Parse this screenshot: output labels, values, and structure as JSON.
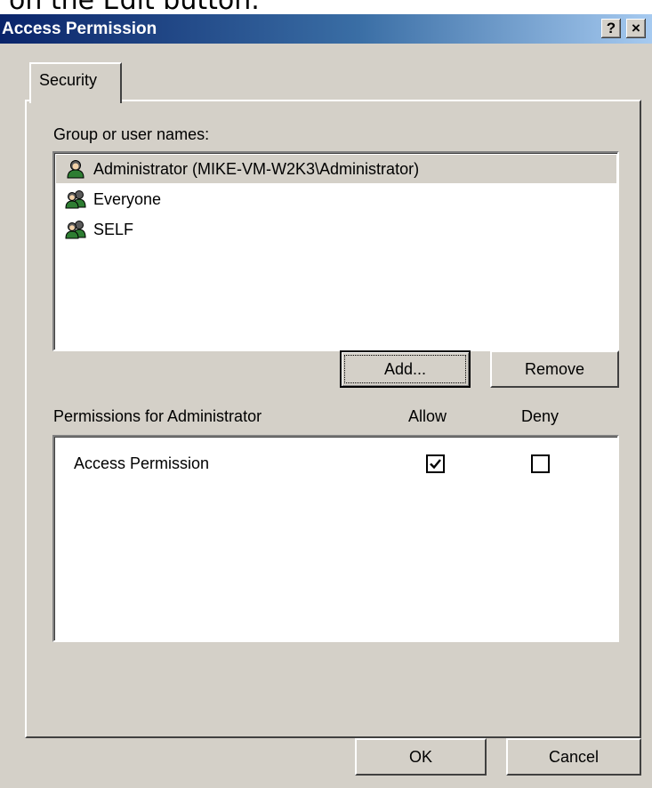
{
  "caption_fragment": "on the Edit button.",
  "window": {
    "title": "Access Permission",
    "help_label": "?",
    "close_label": "×"
  },
  "tabs": [
    {
      "label": "Security",
      "selected": true
    }
  ],
  "users": {
    "label": "Group or user names:",
    "items": [
      {
        "label": "Administrator (MIKE-VM-W2K3\\Administrator)",
        "icon": "single-user-icon",
        "selected": true
      },
      {
        "label": "Everyone",
        "icon": "group-users-icon",
        "selected": false
      },
      {
        "label": "SELF",
        "icon": "group-users-icon",
        "selected": false
      }
    ]
  },
  "buttons": {
    "add_label": "Add...",
    "remove_label": "Remove",
    "ok_label": "OK",
    "cancel_label": "Cancel"
  },
  "permissions": {
    "label": "Permissions for Administrator",
    "allow_header": "Allow",
    "deny_header": "Deny",
    "rows": [
      {
        "name": "Access Permission",
        "allow": true,
        "deny": false
      }
    ]
  },
  "colors": {
    "dialog_face": "#d4d0c8",
    "title_gradient_start": "#0a246a",
    "title_gradient_end": "#a6caf0"
  }
}
